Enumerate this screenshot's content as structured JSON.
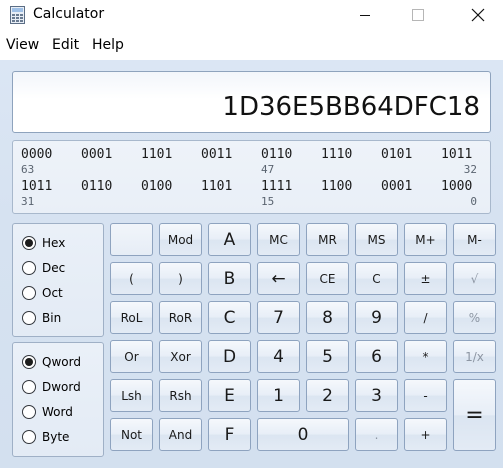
{
  "window": {
    "title": "Calculator",
    "controls": [
      "minimize-icon",
      "maximize-icon",
      "close-icon"
    ]
  },
  "menu": {
    "items": [
      "View",
      "Edit",
      "Help"
    ]
  },
  "display": {
    "value": "1D36E5BB64DFC18"
  },
  "bit_display": {
    "rows": [
      {
        "nibbles": [
          "0000",
          "0001",
          "1101",
          "0011",
          "0110",
          "1110",
          "0101",
          "1011"
        ],
        "left_pos": "63",
        "mid_pos": "47",
        "right_pos": "32"
      },
      {
        "nibbles": [
          "1011",
          "0110",
          "0100",
          "1101",
          "1111",
          "1100",
          "0001",
          "1000"
        ],
        "left_pos": "31",
        "mid_pos": "15",
        "right_pos": "0"
      }
    ]
  },
  "number_base": {
    "options": [
      "Hex",
      "Dec",
      "Oct",
      "Bin"
    ],
    "selected": "Hex"
  },
  "word_size": {
    "options": [
      "Qword",
      "Dword",
      "Word",
      "Byte"
    ],
    "selected": "Qword"
  },
  "keys": {
    "row1": [
      "",
      "Mod",
      "A",
      "MC",
      "MR",
      "MS",
      "M+",
      "M-"
    ],
    "row2": [
      "(",
      ")",
      "B",
      "←",
      "CE",
      "C",
      "±",
      "√"
    ],
    "row3": [
      "RoL",
      "RoR",
      "C",
      "7",
      "8",
      "9",
      "/",
      "%"
    ],
    "row4": [
      "Or",
      "Xor",
      "D",
      "4",
      "5",
      "6",
      "*",
      "1/x"
    ],
    "row5": [
      "Lsh",
      "Rsh",
      "E",
      "1",
      "2",
      "3",
      "-",
      "="
    ],
    "row6": [
      "Not",
      "And",
      "F",
      "0",
      ".",
      "+"
    ]
  }
}
